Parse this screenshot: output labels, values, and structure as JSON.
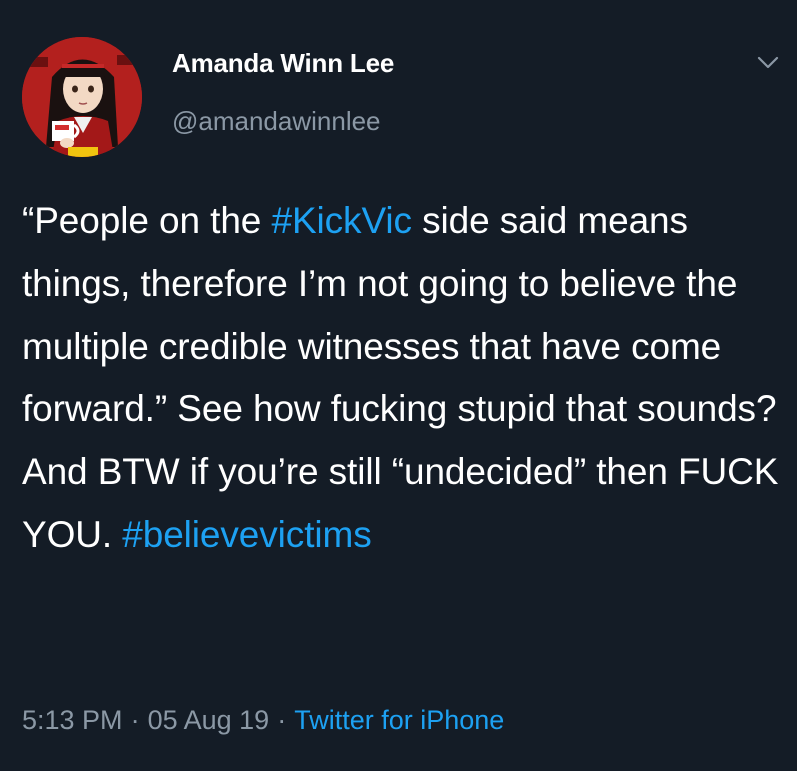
{
  "author": {
    "name": "Amanda Winn Lee",
    "handle": "@amandawinnlee",
    "avatar_icon": "profile-avatar-anime-character"
  },
  "menu": {
    "icon": "chevron-down-icon"
  },
  "tweet": {
    "quote_open": "“People on the ",
    "hashtag1": "#KickVic",
    "text_mid": " side said means things, therefore I’m not going to believe the multiple credible witnesses that have come forward.” See how fucking stupid that sounds? And BTW if you’re still “undecided” then FUCK YOU.  ",
    "hashtag2": "#believevictims"
  },
  "meta": {
    "time": "5:13 PM",
    "date": "05 Aug 19",
    "separator": "·",
    "source": "Twitter for iPhone"
  },
  "colors": {
    "background": "#141c26",
    "link": "#1da1f2",
    "secondary_text": "#8b98a5",
    "primary_text": "#ffffff"
  }
}
